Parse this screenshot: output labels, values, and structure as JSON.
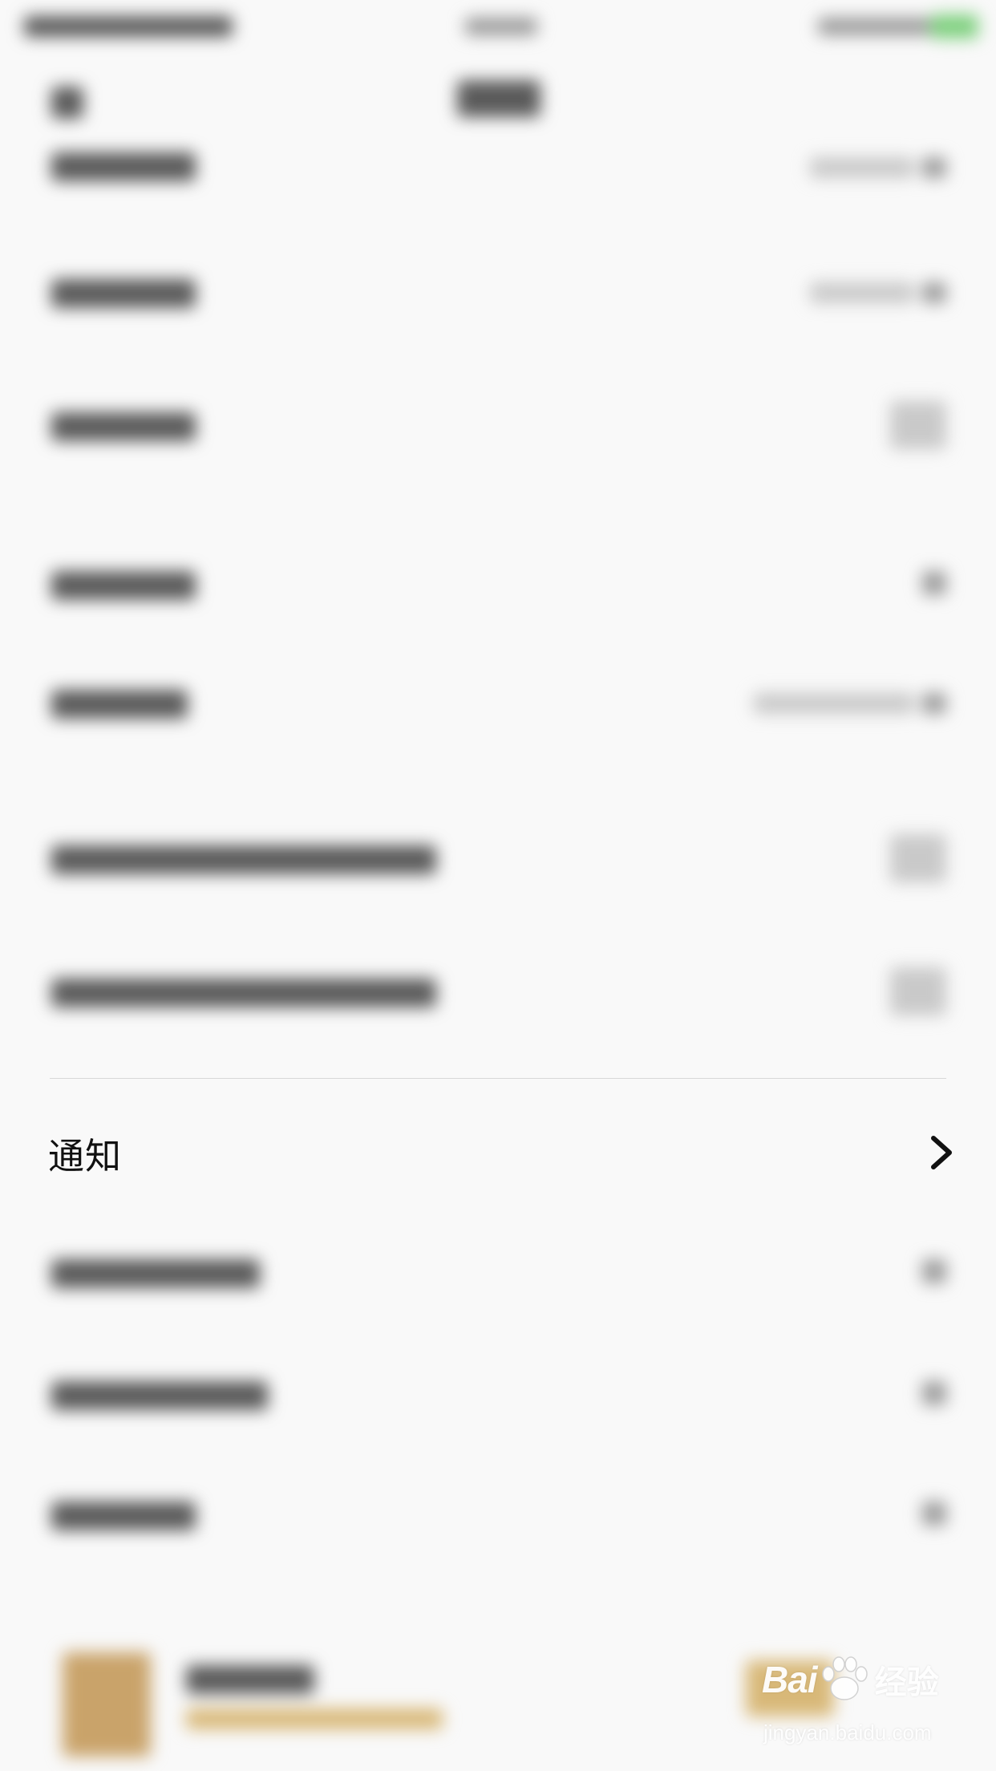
{
  "list": {
    "notification_label": "通知"
  },
  "watermark": {
    "brand": "Bai",
    "brand_cn": "经验",
    "url": "jingyan.baidu.com"
  },
  "icons": {
    "row_chevron": "chevron-right-icon",
    "watermark_paw": "paw-icon"
  }
}
